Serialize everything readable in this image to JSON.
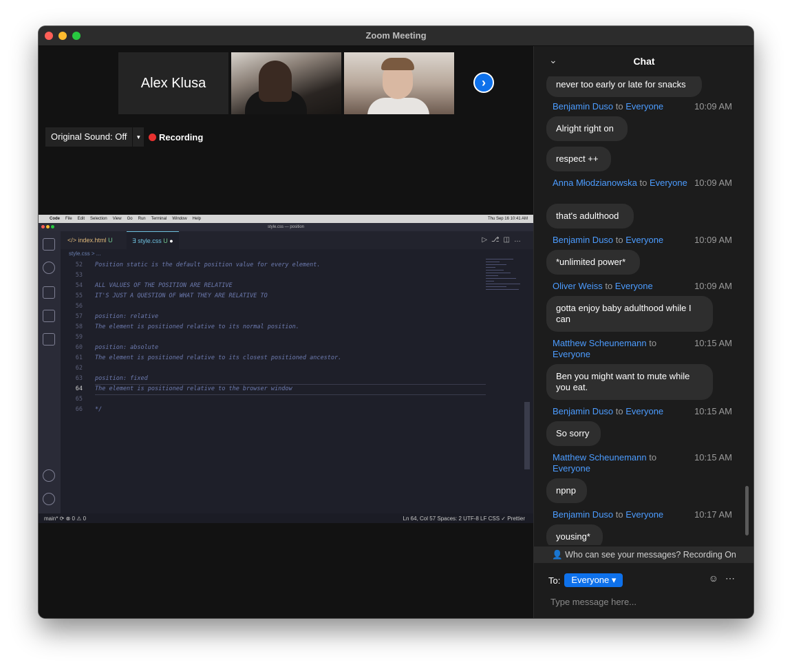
{
  "window": {
    "title": "Zoom Meeting"
  },
  "participants": [
    {
      "name": "Alex Klusa"
    }
  ],
  "controls": {
    "original_sound": "Original Sound: Off",
    "recording": "Recording"
  },
  "shared_screen": {
    "menubar": {
      "app": "Code",
      "items": [
        "File",
        "Edit",
        "Selection",
        "View",
        "Go",
        "Run",
        "Terminal",
        "Window",
        "Help"
      ],
      "clock": "Thu Sep 16  10:41 AM"
    },
    "vscode_title": "style.css — position",
    "tabs": [
      {
        "label": "index.html",
        "status": "U"
      },
      {
        "label": "style.css",
        "status": "U"
      }
    ],
    "breadcrumb": "style.css > ...",
    "code_lines": [
      {
        "n": "52",
        "text": "Position static is the default position value for every element."
      },
      {
        "n": "53",
        "text": ""
      },
      {
        "n": "54",
        "text": "ALL VALUES OF THE POSITION ARE RELATIVE"
      },
      {
        "n": "55",
        "text": "IT'S JUST A QUESTION OF WHAT THEY ARE RELATIVE TO"
      },
      {
        "n": "56",
        "text": ""
      },
      {
        "n": "57",
        "text": "position: relative"
      },
      {
        "n": "58",
        "text": "The element is positioned relative to its normal position."
      },
      {
        "n": "59",
        "text": ""
      },
      {
        "n": "60",
        "text": "position: absolute"
      },
      {
        "n": "61",
        "text": "The element is positioned relative to its closest positioned ancestor."
      },
      {
        "n": "62",
        "text": ""
      },
      {
        "n": "63",
        "text": "position: fixed"
      },
      {
        "n": "64",
        "text": "The element is positioned relative to the browser window"
      },
      {
        "n": "65",
        "text": ""
      },
      {
        "n": "66",
        "text": "*/"
      }
    ],
    "status_left": "main*   ⟳   ⊗ 0 ⚠ 0",
    "status_right": "Ln 64, Col 57    Spaces: 2    UTF-8    LF    CSS    ✓ Prettier"
  },
  "chat": {
    "title": "Chat",
    "top_partial": "never too early or late for snacks",
    "messages": [
      {
        "sender": "Benjamin Duso",
        "to": "to",
        "target": "Everyone",
        "time": "10:09 AM",
        "texts": [
          "Alright right on",
          "respect ++"
        ]
      },
      {
        "sender": "Anna Młodzianowska",
        "to": "to",
        "target": "Everyone",
        "time": "10:09 AM",
        "texts": [
          "that's adulthood"
        ]
      },
      {
        "sender": "Benjamin Duso",
        "to": "to",
        "target": "Everyone",
        "time": "10:09 AM",
        "texts": [
          "*unlimited power*"
        ]
      },
      {
        "sender": "Oliver Weiss",
        "to": "to",
        "target": "Everyone",
        "time": "10:09 AM",
        "texts": [
          "gotta enjoy baby adulthood while I can"
        ]
      },
      {
        "sender": "Matthew Scheunemann",
        "to": "to",
        "target": "Everyone",
        "time": "10:15 AM",
        "texts": [
          "Ben you might want to mute while you eat."
        ]
      },
      {
        "sender": "Benjamin Duso",
        "to": "to",
        "target": "Everyone",
        "time": "10:15 AM",
        "texts": [
          "So sorry"
        ]
      },
      {
        "sender": "Matthew Scheunemann",
        "to": "to",
        "target": "Everyone",
        "time": "10:15 AM",
        "texts": [
          "npnp"
        ]
      },
      {
        "sender": "Benjamin Duso",
        "to": "to",
        "target": "Everyone",
        "time": "10:17 AM",
        "texts": [
          "yousing*"
        ]
      }
    ],
    "notice": "Who can see your messages? Recording On",
    "to_label": "To:",
    "recipient": "Everyone",
    "placeholder": "Type message here..."
  },
  "colors": {
    "accent": "#0e71eb",
    "link": "#4c9cff",
    "recording": "#e8312f"
  }
}
